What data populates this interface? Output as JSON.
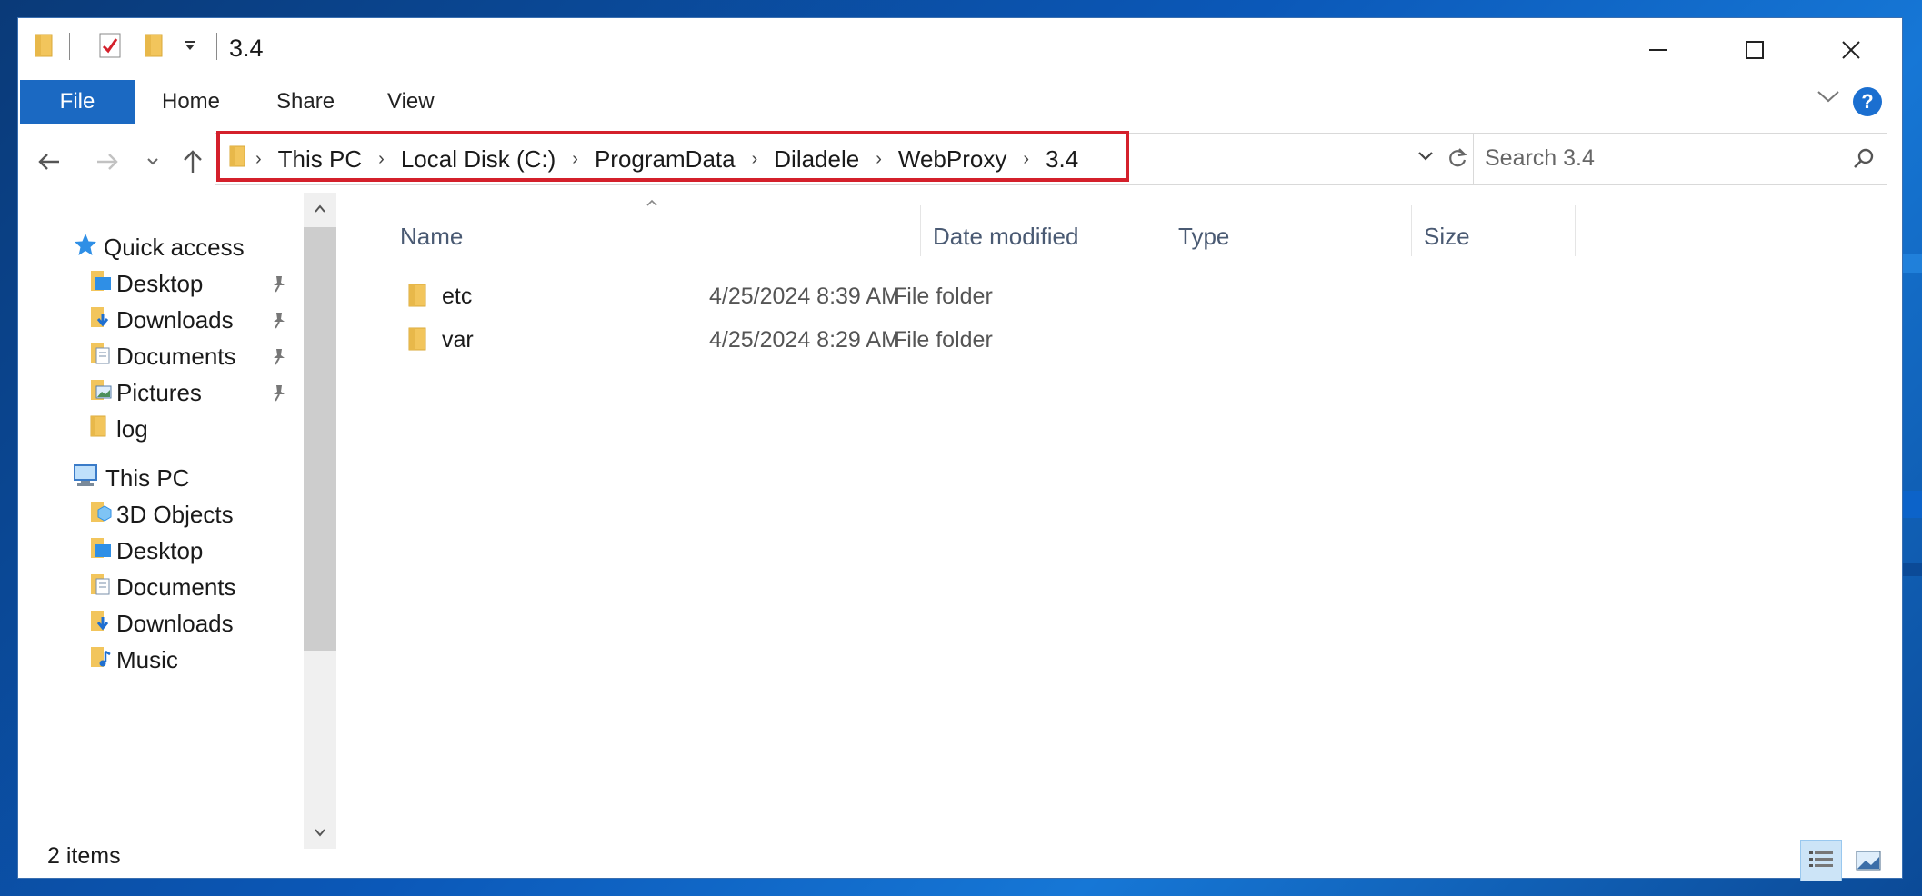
{
  "window": {
    "title": "3.4"
  },
  "ribbon": {
    "tabs": [
      "File",
      "Home",
      "Share",
      "View"
    ],
    "help_label": "?"
  },
  "address": {
    "crumbs": [
      "This PC",
      "Local Disk (C:)",
      "ProgramData",
      "Diladele",
      "WebProxy",
      "3.4"
    ]
  },
  "search": {
    "placeholder": "Search 3.4"
  },
  "nav": {
    "quick_access": "Quick access",
    "quick_items": [
      "Desktop",
      "Downloads",
      "Documents",
      "Pictures",
      "log"
    ],
    "this_pc": "This PC",
    "pc_items": [
      "3D Objects",
      "Desktop",
      "Documents",
      "Downloads",
      "Music"
    ]
  },
  "columns": {
    "name": "Name",
    "date": "Date modified",
    "type": "Type",
    "size": "Size"
  },
  "files": [
    {
      "name": "etc",
      "date": "4/25/2024 8:39 AM",
      "type": "File folder",
      "size": ""
    },
    {
      "name": "var",
      "date": "4/25/2024 8:29 AM",
      "type": "File folder",
      "size": ""
    }
  ],
  "status": {
    "count": "2 items"
  },
  "colors": {
    "accent": "#1b69c2",
    "highlight": "#d4202b",
    "folder": "#f2c55c"
  }
}
